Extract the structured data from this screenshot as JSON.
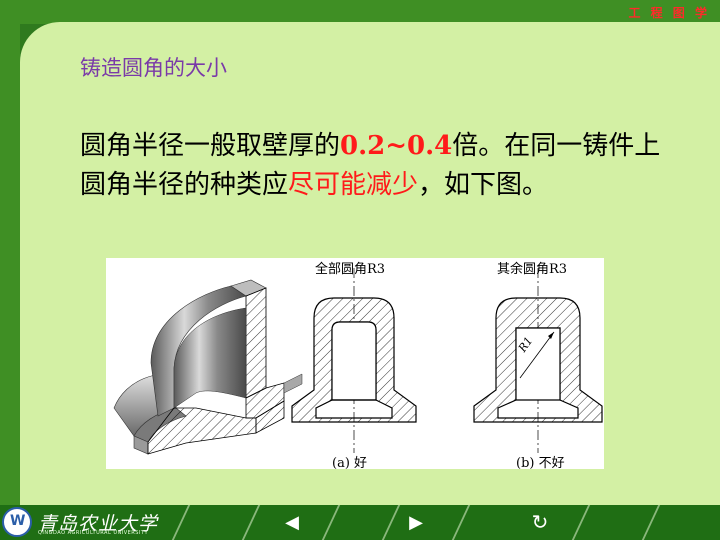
{
  "header": {
    "brand": "工 程 图 学"
  },
  "slide": {
    "subtitle": "铸造圆角的大小",
    "paragraph": {
      "part1": "圆角半径一般取壁厚的",
      "ratio": "0.2~0.4",
      "part2": "倍。在同一铸件上圆角半径的种类应",
      "emphasis": "尽可能减少",
      "part3": "，如下图。"
    }
  },
  "figure": {
    "label_a_top": "全部圆角R3",
    "label_b_top": "其余圆角R3",
    "label_r1": "R1",
    "caption_a": "(a) 好",
    "caption_b": "(b) 不好"
  },
  "footer": {
    "university_cn": "青岛农业大学",
    "university_en": "QINGDAO AGRICULTURAL UNIVERSITY",
    "prev_label": "◀",
    "next_label": "▶",
    "return_label": "↻"
  },
  "colors": {
    "accent_red": "#ff1a1a",
    "subtitle_purple": "#7a3aa8",
    "slide_bg": "#d3f0a4",
    "frame_green": "#2f7a1e"
  }
}
